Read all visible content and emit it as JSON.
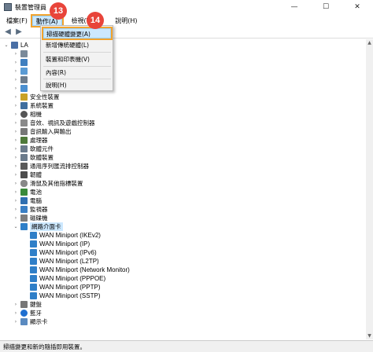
{
  "window": {
    "title": "裝置管理員",
    "minimize": "—",
    "maximize": "☐",
    "close": "✕"
  },
  "menubar": [
    {
      "label": "檔案(F)"
    },
    {
      "label": "動作(A)"
    },
    {
      "label": "檢視(V)"
    },
    {
      "label": "說明(H)"
    }
  ],
  "dropdown": {
    "items": [
      "掃描硬體變更(A)",
      "新增傳統硬體(L)",
      "裝置和印表機(V)",
      "內容(R)",
      "說明(H)"
    ]
  },
  "badges": {
    "step1": "13",
    "step2": "14"
  },
  "tree": {
    "root": "LA",
    "categories": [
      "安全性裝置",
      "系統裝置",
      "相機",
      "音效、視訊及遊戲控制器",
      "音訊輸入與輸出",
      "處理器",
      "軟體元件",
      "軟體裝置",
      "通用序列匯流排控制器",
      "韌體",
      "滑鼠及其他指標裝置",
      "電池",
      "電腦",
      "監視器",
      "磁碟機",
      "網路介面卡"
    ],
    "network_adapters": [
      "WAN Miniport (IKEv2)",
      "WAN Miniport (IP)",
      "WAN Miniport (IPv6)",
      "WAN Miniport (L2TP)",
      "WAN Miniport (Network Monitor)",
      "WAN Miniport (PPPOE)",
      "WAN Miniport (PPTP)",
      "WAN Miniport (SSTP)"
    ],
    "after": [
      "鍵盤",
      "藍牙",
      "顯示卡"
    ]
  },
  "status": {
    "text": "掃描變更和新的隨插即用裝置。"
  },
  "colors": {
    "accent": "#f2a32d",
    "badge": "#e8443a",
    "selection": "#cce8ff"
  }
}
